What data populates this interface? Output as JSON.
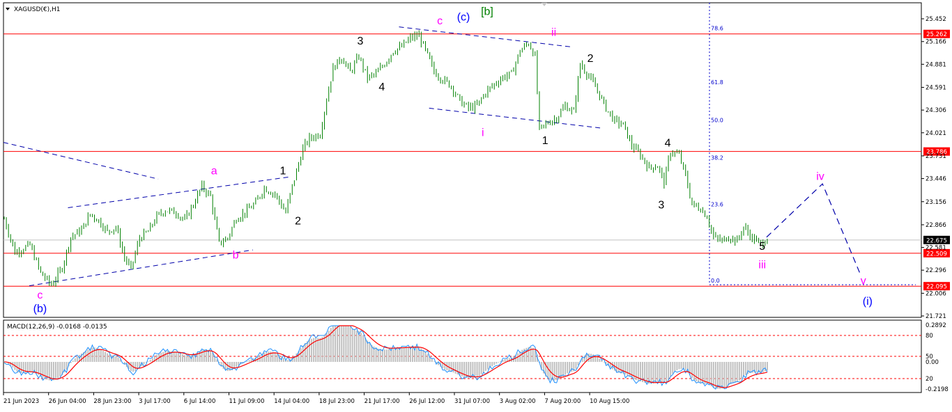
{
  "chart_data": [
    {
      "type": "candlestick",
      "title": "XAGUSD(€),H1",
      "ylim": [
        21.721,
        25.452
      ],
      "y_ticks": [
        25.452,
        25.166,
        24.881,
        24.591,
        24.306,
        24.021,
        23.731,
        23.446,
        23.156,
        22.866,
        22.581,
        22.296,
        22.006,
        21.721
      ],
      "x_ticks": [
        "21 Jun 2023",
        "26 Jun 04:00",
        "28 Jun 23:00",
        "3 Jul 17:00",
        "6 Jul 14:00",
        "11 Jul 09:00",
        "14 Jul 04:00",
        "18 Jul 23:00",
        "21 Jul 17:00",
        "26 Jul 12:00",
        "31 Jul 07:00",
        "3 Aug 02:00",
        "7 Aug 20:00",
        "10 Aug 15:00"
      ],
      "price_path": [
        [
          0,
          22.94
        ],
        [
          5,
          22.52
        ],
        [
          12,
          22.61
        ],
        [
          17,
          22.26
        ],
        [
          22,
          22.11
        ],
        [
          27,
          22.33
        ],
        [
          31,
          22.71
        ],
        [
          36,
          22.8
        ],
        [
          40,
          23.0
        ],
        [
          44,
          22.92
        ],
        [
          48,
          22.78
        ],
        [
          52,
          22.84
        ],
        [
          56,
          22.45
        ],
        [
          59,
          22.31
        ],
        [
          63,
          22.7
        ],
        [
          67,
          22.78
        ],
        [
          71,
          22.97
        ],
        [
          75,
          23.05
        ],
        [
          80,
          23.02
        ],
        [
          84,
          22.92
        ],
        [
          88,
          23.12
        ],
        [
          92,
          23.35
        ],
        [
          96,
          23.22
        ],
        [
          100,
          22.63
        ],
        [
          104,
          22.7
        ],
        [
          108,
          22.95
        ],
        [
          112,
          23.02
        ],
        [
          117,
          23.14
        ],
        [
          121,
          23.33
        ],
        [
          126,
          23.25
        ],
        [
          131,
          23.02
        ],
        [
          134,
          23.35
        ],
        [
          139,
          23.82
        ],
        [
          142,
          23.95
        ],
        [
          147,
          24.01
        ],
        [
          150,
          24.44
        ],
        [
          153,
          24.83
        ],
        [
          157,
          24.97
        ],
        [
          161,
          24.78
        ],
        [
          165,
          24.98
        ],
        [
          169,
          24.71
        ],
        [
          173,
          24.76
        ],
        [
          177,
          24.89
        ],
        [
          181,
          25.05
        ],
        [
          185,
          25.1
        ],
        [
          189,
          25.21
        ],
        [
          193,
          25.24
        ],
        [
          197,
          24.99
        ],
        [
          200,
          24.79
        ],
        [
          204,
          24.69
        ],
        [
          208,
          24.61
        ],
        [
          212,
          24.42
        ],
        [
          216,
          24.33
        ],
        [
          220,
          24.36
        ],
        [
          224,
          24.53
        ],
        [
          228,
          24.63
        ],
        [
          232,
          24.72
        ],
        [
          236,
          24.76
        ],
        [
          240,
          25.05
        ],
        [
          244,
          25.15
        ],
        [
          247,
          24.98
        ],
        [
          249,
          24.06
        ],
        [
          253,
          24.15
        ],
        [
          257,
          24.21
        ],
        [
          261,
          24.36
        ],
        [
          265,
          24.28
        ],
        [
          268,
          24.89
        ],
        [
          272,
          24.73
        ],
        [
          276,
          24.55
        ],
        [
          280,
          24.33
        ],
        [
          284,
          24.17
        ],
        [
          288,
          24.12
        ],
        [
          292,
          23.86
        ],
        [
          296,
          23.74
        ],
        [
          300,
          23.58
        ],
        [
          304,
          23.61
        ],
        [
          307,
          23.4
        ],
        [
          310,
          23.79
        ],
        [
          314,
          23.74
        ],
        [
          317,
          23.48
        ],
        [
          320,
          23.12
        ],
        [
          324,
          23.07
        ],
        [
          327,
          22.97
        ],
        [
          330,
          22.71
        ],
        [
          334,
          22.66
        ],
        [
          337,
          22.72
        ],
        [
          341,
          22.66
        ],
        [
          344,
          22.84
        ],
        [
          348,
          22.7
        ],
        [
          352,
          22.62
        ],
        [
          355,
          22.71
        ]
      ],
      "horizontal_levels": [
        25.262,
        23.786,
        22.509,
        22.095
      ],
      "current_price": 22.675,
      "fibonacci_levels": [
        {
          "label": "78.6",
          "value": 25.28
        },
        {
          "label": "61.8",
          "value": 24.605
        },
        {
          "label": "50.0",
          "value": 24.13
        },
        {
          "label": "38.2",
          "value": 23.655
        },
        {
          "label": "23.6",
          "value": 23.07
        },
        {
          "label": "0.0",
          "value": 22.113
        }
      ],
      "wave_labels": [
        {
          "text": "c",
          "color": "#ff00ff",
          "x": 17,
          "y": 21.94
        },
        {
          "text": "(b)",
          "color": "#0000ff",
          "x": 17,
          "y": 21.77
        },
        {
          "text": "a",
          "color": "#ff00ff",
          "x": 98,
          "y": 23.5
        },
        {
          "text": "b",
          "color": "#ff00ff",
          "x": 108,
          "y": 22.44
        },
        {
          "text": "1",
          "color": "#000000",
          "x": 130,
          "y": 23.5
        },
        {
          "text": "2",
          "color": "#000000",
          "x": 137,
          "y": 22.87
        },
        {
          "text": "3",
          "color": "#000000",
          "x": 166,
          "y": 25.13
        },
        {
          "text": "4",
          "color": "#000000",
          "x": 176,
          "y": 24.55
        },
        {
          "text": "c",
          "color": "#ff00ff",
          "x": 203,
          "y": 25.38
        },
        {
          "text": "(c)",
          "color": "#0000ff",
          "x": 214,
          "y": 25.43
        },
        {
          "text": "[b]",
          "color": "#008000",
          "x": 225,
          "y": 25.5
        },
        {
          "text": "ii",
          "color": "#ff00ff",
          "x": 256,
          "y": 25.24
        },
        {
          "text": "i",
          "color": "#ff00ff",
          "x": 223,
          "y": 23.98
        },
        {
          "text": "1",
          "color": "#000000",
          "x": 252,
          "y": 23.88
        },
        {
          "text": "2",
          "color": "#000000",
          "x": 273,
          "y": 24.91
        },
        {
          "text": "4",
          "color": "#000000",
          "x": 309,
          "y": 23.85
        },
        {
          "text": "3",
          "color": "#000000",
          "x": 306,
          "y": 23.07
        },
        {
          "text": "5",
          "color": "#000000",
          "x": 353,
          "y": 22.55
        },
        {
          "text": "iii",
          "color": "#ff00ff",
          "x": 353,
          "y": 22.32
        },
        {
          "text": "iv",
          "color": "#ff00ff",
          "x": 380,
          "y": 23.43
        },
        {
          "text": "v",
          "color": "#ff00ff",
          "x": 400,
          "y": 22.12
        },
        {
          "text": "(i)",
          "color": "#0000ff",
          "x": 402,
          "y": 21.86
        }
      ],
      "projection_path": [
        [
          355,
          22.71
        ],
        [
          381,
          23.38
        ],
        [
          399,
          22.22
        ]
      ],
      "trend_lines": [
        [
          [
            0,
            23.9
          ],
          [
            72,
            23.44
          ]
        ],
        [
          [
            12,
            22.1
          ],
          [
            116,
            22.55
          ]
        ],
        [
          [
            30,
            23.08
          ],
          [
            134,
            23.47
          ]
        ],
        [
          [
            184,
            25.35
          ],
          [
            264,
            25.1
          ]
        ],
        [
          [
            198,
            24.33
          ],
          [
            278,
            24.08
          ]
        ]
      ]
    },
    {
      "type": "macd",
      "title": "MACD(12,26,9) -0.0168 -0.0135",
      "ylim": [
        -0.2198,
        0.2892
      ],
      "y_ticks": [
        "0.2892",
        "80",
        "50",
        "0.00",
        "20",
        "-0.2198"
      ]
    }
  ],
  "colors": {
    "level": "#ff0000",
    "trend": "#0000aa",
    "candle": "#008000",
    "macd_hist": "#c0c0c0",
    "macd_signal": "#ff0000",
    "macd_line": "#1e90ff",
    "badge_bg": "#ff0000",
    "current_bg": "#000000"
  }
}
